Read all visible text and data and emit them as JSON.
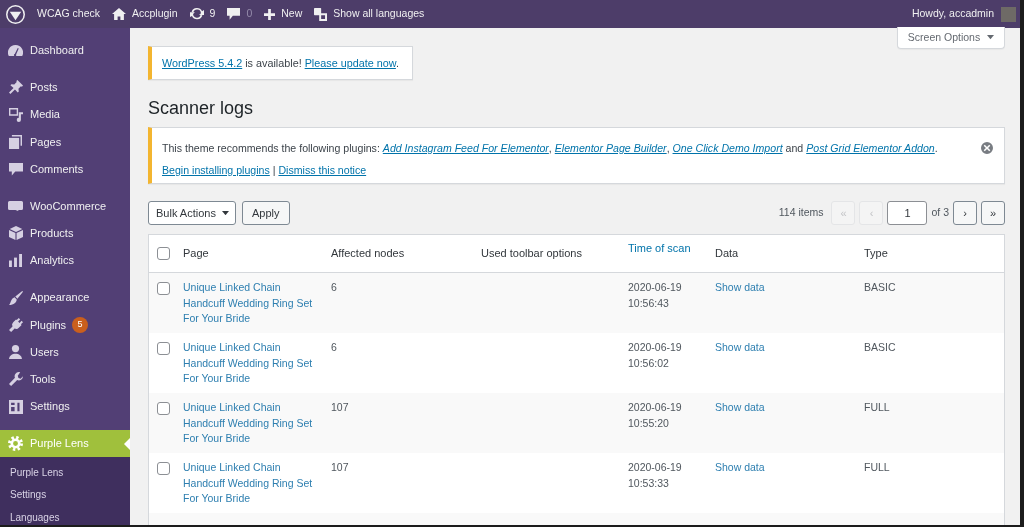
{
  "admin_bar": {
    "items": [
      {
        "kind": "site",
        "label": "WCAG check",
        "dimmed": false
      },
      {
        "kind": "home",
        "label": "Accplugin",
        "dimmed": false
      },
      {
        "kind": "updates",
        "label": "9",
        "dimmed": false
      },
      {
        "kind": "comments",
        "label": "0",
        "dimmed": true
      },
      {
        "kind": "new",
        "label": "New",
        "dimmed": false
      },
      {
        "kind": "languages",
        "label": "Show all languages",
        "dimmed": false
      }
    ],
    "greeting": "Howdy, accadmin"
  },
  "sidebar": {
    "menu_groups": [
      [
        {
          "label": "Dashboard",
          "selected": false
        }
      ],
      [
        {
          "label": "Posts",
          "selected": false
        },
        {
          "label": "Media",
          "selected": false
        },
        {
          "label": "Pages",
          "selected": false
        },
        {
          "label": "Comments",
          "selected": false
        }
      ],
      [
        {
          "label": "WooCommerce",
          "selected": false
        },
        {
          "label": "Products",
          "selected": false
        },
        {
          "label": "Analytics",
          "selected": false
        }
      ],
      [
        {
          "label": "Appearance",
          "selected": false
        },
        {
          "label": "Plugins",
          "selected": false,
          "badge": "5"
        },
        {
          "label": "Users",
          "selected": false
        },
        {
          "label": "Tools",
          "selected": false
        },
        {
          "label": "Settings",
          "selected": false
        }
      ],
      [
        {
          "label": "Purple Lens",
          "selected": true,
          "children": [
            {
              "label": "Purple Lens",
              "selected": false
            },
            {
              "label": "Settings",
              "selected": false
            },
            {
              "label": "Languages",
              "selected": false
            }
          ]
        }
      ]
    ]
  },
  "update_notice": {
    "dismissible": false,
    "lines": [
      [
        {
          "kind": "link",
          "text": "WordPress 5.4.2"
        },
        {
          "kind": "text",
          "text": " is available! "
        },
        {
          "kind": "link",
          "text": "Please update now"
        },
        {
          "kind": "text",
          "text": "."
        }
      ]
    ]
  },
  "screen_options": "Screen Options",
  "page_title": "Scanner logs",
  "plugin_notice": {
    "dismissible": true,
    "lines": [
      [
        {
          "kind": "text",
          "text": "This theme recommends the following plugins: "
        },
        {
          "kind": "italic_link",
          "text": "Add Instagram Feed For Elementor"
        },
        {
          "kind": "text",
          "text": ", "
        },
        {
          "kind": "italic_link",
          "text": "Elementor Page Builder"
        },
        {
          "kind": "text",
          "text": ", "
        },
        {
          "kind": "italic_link",
          "text": "One Click Demo Import"
        },
        {
          "kind": "text",
          "text": " and "
        },
        {
          "kind": "italic_link",
          "text": "Post Grid Elementor Addon"
        },
        {
          "kind": "text",
          "text": "."
        }
      ],
      [
        {
          "kind": "link",
          "text": "Begin installing plugins"
        },
        {
          "kind": "text",
          "text": " | "
        },
        {
          "kind": "link",
          "text": "Dismiss this notice"
        }
      ]
    ]
  },
  "tablenav": {
    "bulk_actions": "Bulk Actions",
    "apply": "Apply",
    "items_count": "114 items",
    "pagination": {
      "first": {
        "label": "«",
        "disabled": true
      },
      "previous": {
        "label": "‹",
        "disabled": true
      },
      "current_page": "1",
      "total": "of 3",
      "next": {
        "label": "›",
        "disabled": false
      },
      "last": {
        "label": "»",
        "disabled": false
      }
    }
  },
  "table": {
    "select_all_checked": false,
    "columns": [
      {
        "label": "Page",
        "sortable": false
      },
      {
        "label": "Affected nodes",
        "sortable": false
      },
      {
        "label": "Used toolbar options",
        "sortable": false
      },
      {
        "label": "Time of scan",
        "sortable": true
      },
      {
        "label": "Data",
        "sortable": false
      },
      {
        "label": "Type",
        "sortable": false
      }
    ],
    "rows": [
      {
        "checked": false,
        "page": "Unique Linked Chain Handcuff Wedding Ring Set For Your Bride",
        "affected_nodes": "6",
        "time_of_scan": "2020-06-19 10:56:43",
        "data": "Show data",
        "type": "BASIC"
      },
      {
        "checked": false,
        "page": "Unique Linked Chain Handcuff Wedding Ring Set For Your Bride",
        "affected_nodes": "6",
        "time_of_scan": "2020-06-19 10:56:02",
        "data": "Show data",
        "type": "BASIC"
      },
      {
        "checked": false,
        "page": "Unique Linked Chain Handcuff Wedding Ring Set For Your Bride",
        "affected_nodes": "107",
        "time_of_scan": "2020-06-19 10:55:20",
        "data": "Show data",
        "type": "FULL"
      },
      {
        "checked": false,
        "page": "Unique Linked Chain Handcuff Wedding Ring Set For Your Bride",
        "affected_nodes": "107",
        "time_of_scan": "2020-06-19 10:53:33",
        "data": "Show data",
        "type": "FULL"
      }
    ],
    "more_rows_below": true
  }
}
